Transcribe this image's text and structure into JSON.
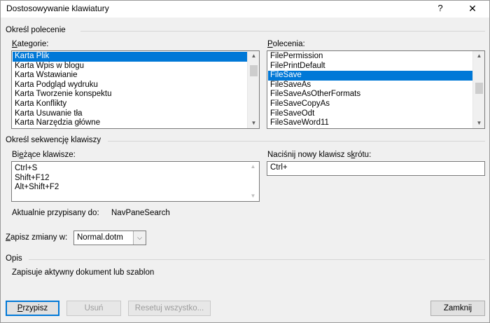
{
  "window": {
    "title": "Dostosowywanie klawiatury",
    "help_glyph": "?",
    "close_glyph": "✕"
  },
  "command_section": {
    "label": "Określ polecenie",
    "categories_label_ul": "K",
    "categories_label_rest": "ategorie:",
    "categories": [
      "Karta Plik",
      "Karta Wpis w blogu",
      "Karta Wstawianie",
      "Karta Podgląd wydruku",
      "Karta Tworzenie konspektu",
      "Karta Konflikty",
      "Karta Usuwanie tła",
      "Karta Narzędzia główne"
    ],
    "categories_selected": "Karta Plik",
    "commands_label_ul": "P",
    "commands_label_rest": "olecenia:",
    "commands": [
      "FilePermission",
      "FilePrintDefault",
      "FileSave",
      "FileSaveAs",
      "FileSaveAsOtherFormats",
      "FileSaveCopyAs",
      "FileSaveOdt",
      "FileSaveWord11"
    ],
    "commands_selected": "FileSave"
  },
  "keys_section": {
    "label": "Określ sekwencję klawiszy",
    "current_label_pre": "Bi",
    "current_label_ul": "e",
    "current_label_post": "żące klawisze:",
    "current_keys": [
      "Ctrl+S",
      "Shift+F12",
      "Alt+Shift+F2"
    ],
    "new_label_pre": "Naciśnij nowy klawisz s",
    "new_label_ul": "k",
    "new_label_post": "rótu:",
    "new_key_value": "Ctrl+",
    "assigned_label": "Aktualnie przypisany do:",
    "assigned_value": "NavPaneSearch"
  },
  "save_in": {
    "label_ul": "Z",
    "label_rest": "apisz zmiany w:",
    "value": "Normal.dotm",
    "dropdown_glyph": "⌵"
  },
  "description": {
    "label": "Opis",
    "text": "Zapisuje aktywny dokument lub szablon"
  },
  "buttons": {
    "assign_ul": "P",
    "assign_rest": "rzypisz",
    "remove_label": "Usuń",
    "reset_label": "Resetuj wszystko...",
    "close_label": "Zamknij"
  },
  "scroll_glyphs": {
    "up": "▲",
    "down": "▼"
  }
}
